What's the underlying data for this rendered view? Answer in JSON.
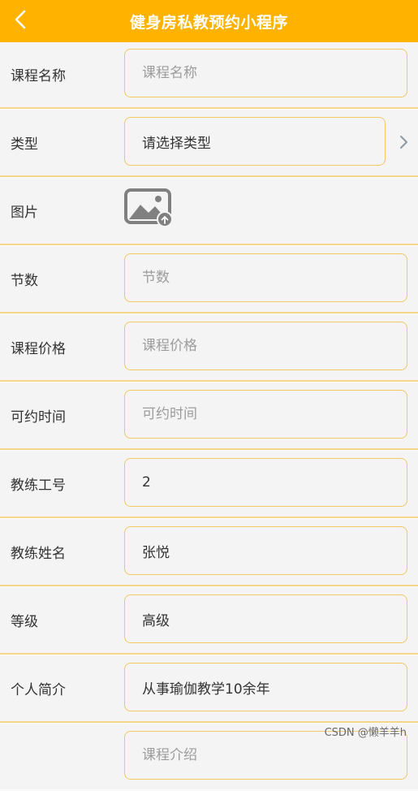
{
  "header": {
    "title": "健身房私教预约小程序"
  },
  "form": {
    "course_name": {
      "label": "课程名称",
      "placeholder": "课程名称",
      "value": ""
    },
    "type": {
      "label": "类型",
      "value": "请选择类型"
    },
    "image": {
      "label": "图片"
    },
    "sessions": {
      "label": "节数",
      "placeholder": "节数",
      "value": ""
    },
    "price": {
      "label": "课程价格",
      "placeholder": "课程价格",
      "value": ""
    },
    "available_time": {
      "label": "可约时间",
      "placeholder": "可约时间",
      "value": ""
    },
    "coach_id": {
      "label": "教练工号",
      "value": "2"
    },
    "coach_name": {
      "label": "教练姓名",
      "value": "张悦"
    },
    "level": {
      "label": "等级",
      "value": "高级"
    },
    "intro": {
      "label": "个人简介",
      "value": "从事瑜伽教学10余年"
    },
    "course_intro": {
      "label": "",
      "placeholder": "课程介绍"
    }
  },
  "watermark": "CSDN @懒羊羊h",
  "colors": {
    "brand": "#ffb300",
    "field_border": "#f3c866",
    "row_divider": "#f6d58a",
    "background": "#f4f4f4",
    "placeholder": "#9c9c9c"
  },
  "icons": {
    "back": "chevron-left-icon",
    "select_arrow": "chevron-right-icon",
    "upload": "image-upload-icon"
  }
}
